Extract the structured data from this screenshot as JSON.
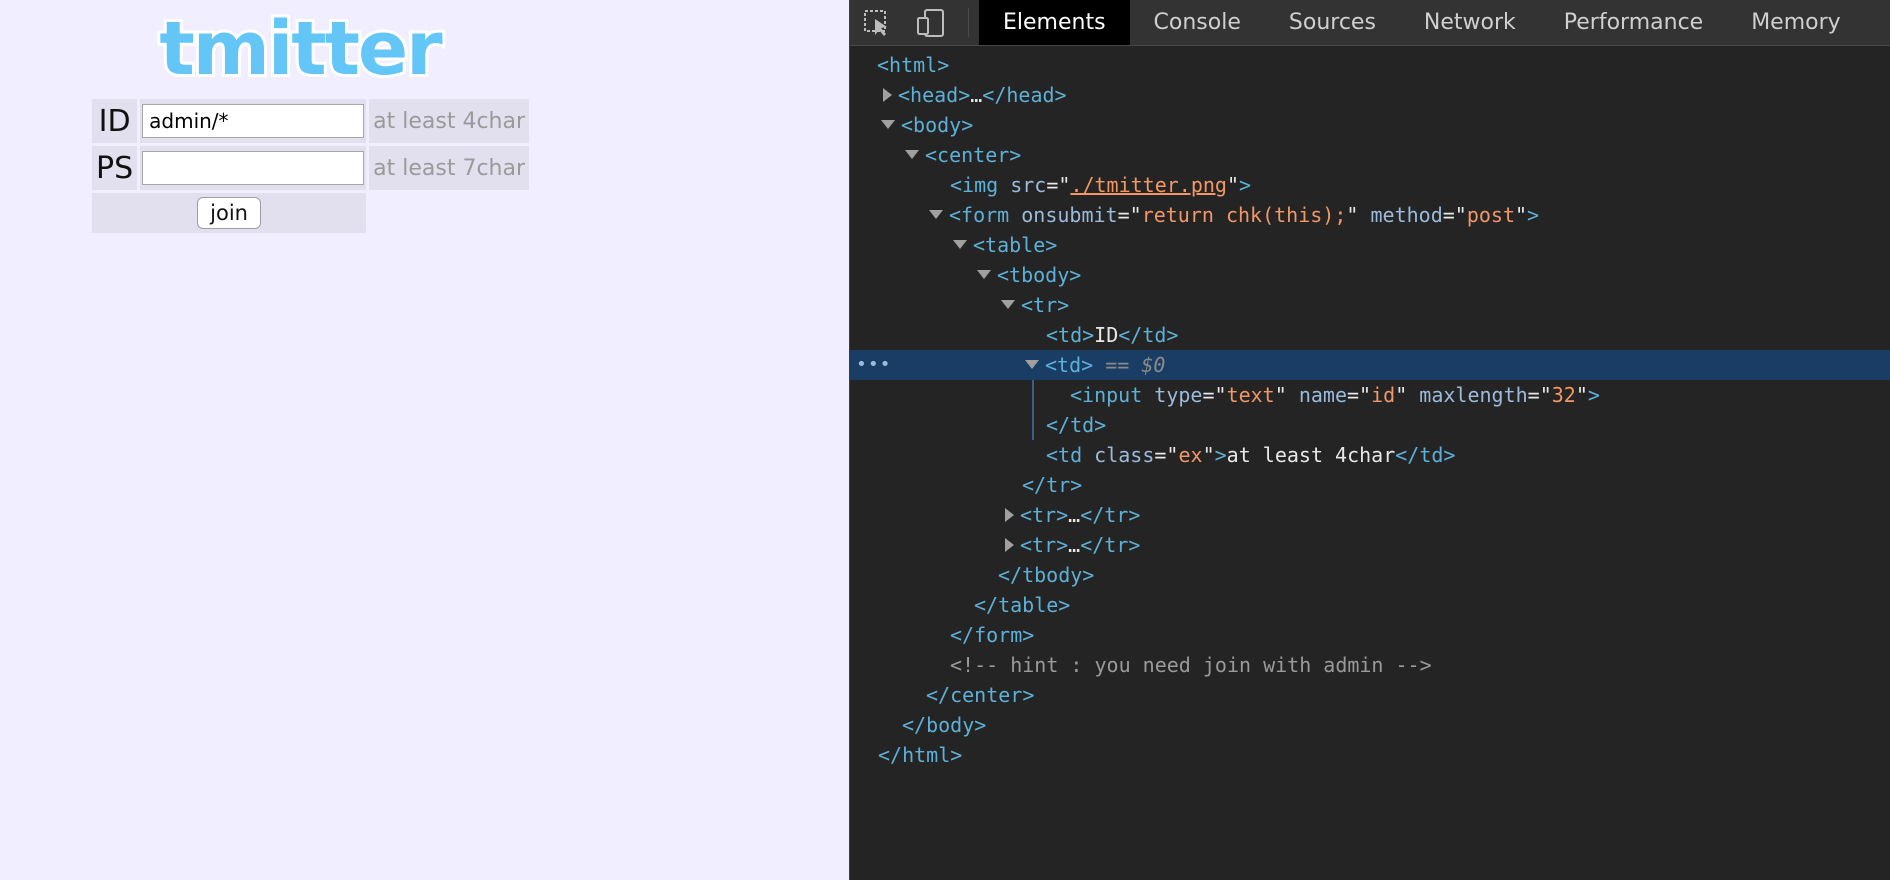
{
  "page": {
    "logo_text": "tmitter",
    "form": {
      "id_label": "ID",
      "id_value": "admin/*",
      "id_hint": "at least 4char",
      "ps_label": "PS",
      "ps_value": "",
      "ps_hint": "at least 7char",
      "join_label": "join"
    },
    "background": "#f0eeff"
  },
  "devtools": {
    "tabs": [
      {
        "label": "Elements",
        "active": true
      },
      {
        "label": "Console"
      },
      {
        "label": "Sources"
      },
      {
        "label": "Network"
      },
      {
        "label": "Performance"
      },
      {
        "label": "Memory"
      }
    ],
    "selected_marker": "== $0",
    "dom": {
      "l1_open": "<html>",
      "l2_head_open": "<head>",
      "l2_head_ell": "…",
      "l2_head_close": "</head>",
      "l3_body": "<body>",
      "l4_center": "<center>",
      "l5_img_tag": "<img",
      "l5_img_attr": "src",
      "l5_img_val": "./tmitter.png",
      "l5_img_end": ">",
      "l6_form_tag": "<form",
      "l6_form_attr1": "onsubmit",
      "l6_form_val1": "return chk(this);",
      "l6_form_attr2": "method",
      "l6_form_val2": "post",
      "l6_form_end": ">",
      "l7_table": "<table>",
      "l8_tbody": "<tbody>",
      "l9_tr": "<tr>",
      "l10_td_open": "<td>",
      "l10_td_text": "ID",
      "l10_td_close": "</td>",
      "l11_td": "<td>",
      "l12_input_tag": "<input",
      "l12_attr1": "type",
      "l12_val1": "text",
      "l12_attr2": "name",
      "l12_val2": "id",
      "l12_attr3": "maxlength",
      "l12_val3": "32",
      "l12_end": ">",
      "l13_td_close": "</td>",
      "l14_td_tag": "<td",
      "l14_attr": "class",
      "l14_val": "ex",
      "l14_gt": ">",
      "l14_text": "at least 4char",
      "l14_close": "</td>",
      "l15_tr_close": "</tr>",
      "l16_tr_open": "<tr>",
      "l16_ell": "…",
      "l16_tr_close": "</tr>",
      "l17_tr_open": "<tr>",
      "l17_ell": "…",
      "l17_tr_close": "</tr>",
      "l18_tbody_close": "</tbody>",
      "l19_table_close": "</table>",
      "l20_form_close": "</form>",
      "l21_comment": "<!-- hint : you need join with admin -->",
      "l22_center_close": "</center>",
      "l23_body_close": "</body>",
      "l24_html_close": "</html>"
    },
    "colors": {
      "tag": "#5db0d7",
      "attr_name": "#9bbbdc",
      "attr_value": "#f29766",
      "selection": "#193d64"
    }
  }
}
